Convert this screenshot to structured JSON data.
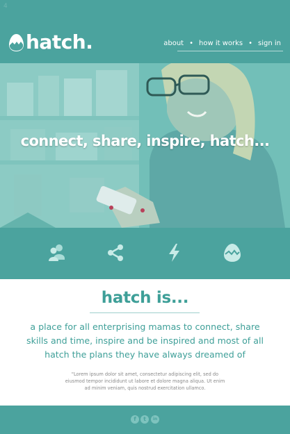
{
  "header": {
    "tiny_mark": "4",
    "logo_text": "hatch.",
    "nav": [
      {
        "label": "about"
      },
      {
        "label": "how it works"
      },
      {
        "label": "sign in"
      }
    ],
    "nav_separator": "•"
  },
  "hero": {
    "tagline": "connect, share, inspire, hatch..."
  },
  "icon_bar": {
    "icons": [
      "community-icon",
      "share-icon",
      "lightning-icon",
      "egg-icon"
    ]
  },
  "intro": {
    "title": "hatch is...",
    "body": "a place for all enterprising mamas to connect, share skills and time, inspire and be inspired and most of all hatch the plans they have always dreamed of",
    "quote": "\"Lorem ipsum dolor sit amet, consectetur adipiscing elit, sed do eiusmod tempor incididunt ut labore et dolore magna aliqua. Ut enim ad minim veniam, quis nostrud exercitation ullamco."
  },
  "footer": {
    "social": [
      {
        "name": "facebook-icon",
        "glyph": "f"
      },
      {
        "name": "twitter-icon",
        "glyph": "t"
      },
      {
        "name": "linkedin-icon",
        "glyph": "in"
      }
    ]
  },
  "colors": {
    "brand_teal": "#4ba39e",
    "text_teal": "#3e9f98",
    "white": "#ffffff"
  }
}
